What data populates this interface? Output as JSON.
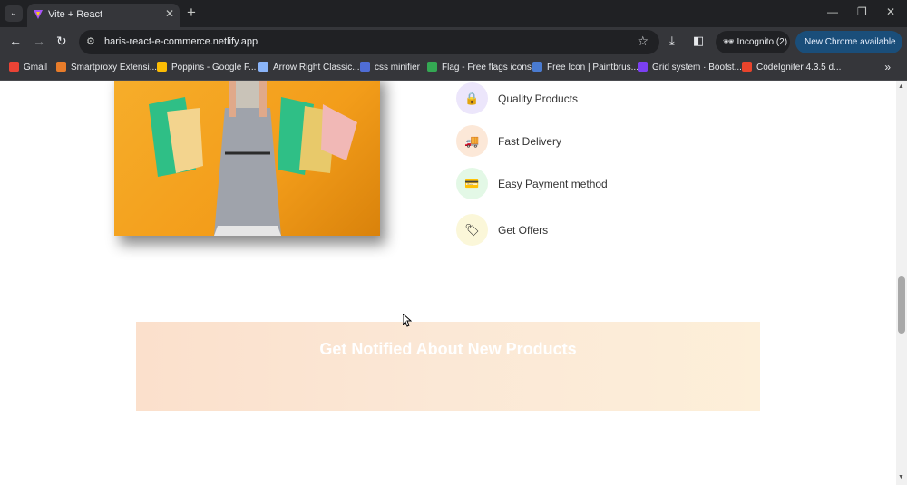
{
  "browser": {
    "tab_title": "Vite + React",
    "url": "haris-react-e-commerce.netlify.app",
    "incognito_label": "Incognito (2)",
    "update_label": "New Chrome available",
    "bookmarks": [
      {
        "label": "Gmail",
        "color": "#ea4335"
      },
      {
        "label": "Smartproxy Extensi...",
        "color": "#e87c2a"
      },
      {
        "label": "Poppins - Google F...",
        "color": "#fbbc04"
      },
      {
        "label": "Arrow Right Classic...",
        "color": "#8ab4f8"
      },
      {
        "label": "css minifier",
        "color": "#4f6dd6"
      },
      {
        "label": "Flag - Free flags icons",
        "color": "#34a853"
      },
      {
        "label": "Free Icon | Paintbrus...",
        "color": "#4a7bd0"
      },
      {
        "label": "Grid system · Bootst...",
        "color": "#7b3ff2"
      },
      {
        "label": "CodeIgniter 4.3.5 d...",
        "color": "#e8442c"
      }
    ]
  },
  "page": {
    "features": [
      {
        "label": "Quality Products",
        "icon": "lock-icon",
        "glyph": "🔒",
        "bg": "#ece6fb"
      },
      {
        "label": "Fast Delivery",
        "icon": "delivery-icon",
        "glyph": "🚚",
        "bg": "#fce8d8"
      },
      {
        "label": "Easy Payment method",
        "icon": "payment-icon",
        "glyph": "💳",
        "bg": "#e3f8e6"
      },
      {
        "label": "Get Offers",
        "icon": "offers-icon",
        "glyph": "🏷",
        "bg": "#fbf7d9"
      }
    ],
    "notify_title": "Get Notified About New Products"
  }
}
